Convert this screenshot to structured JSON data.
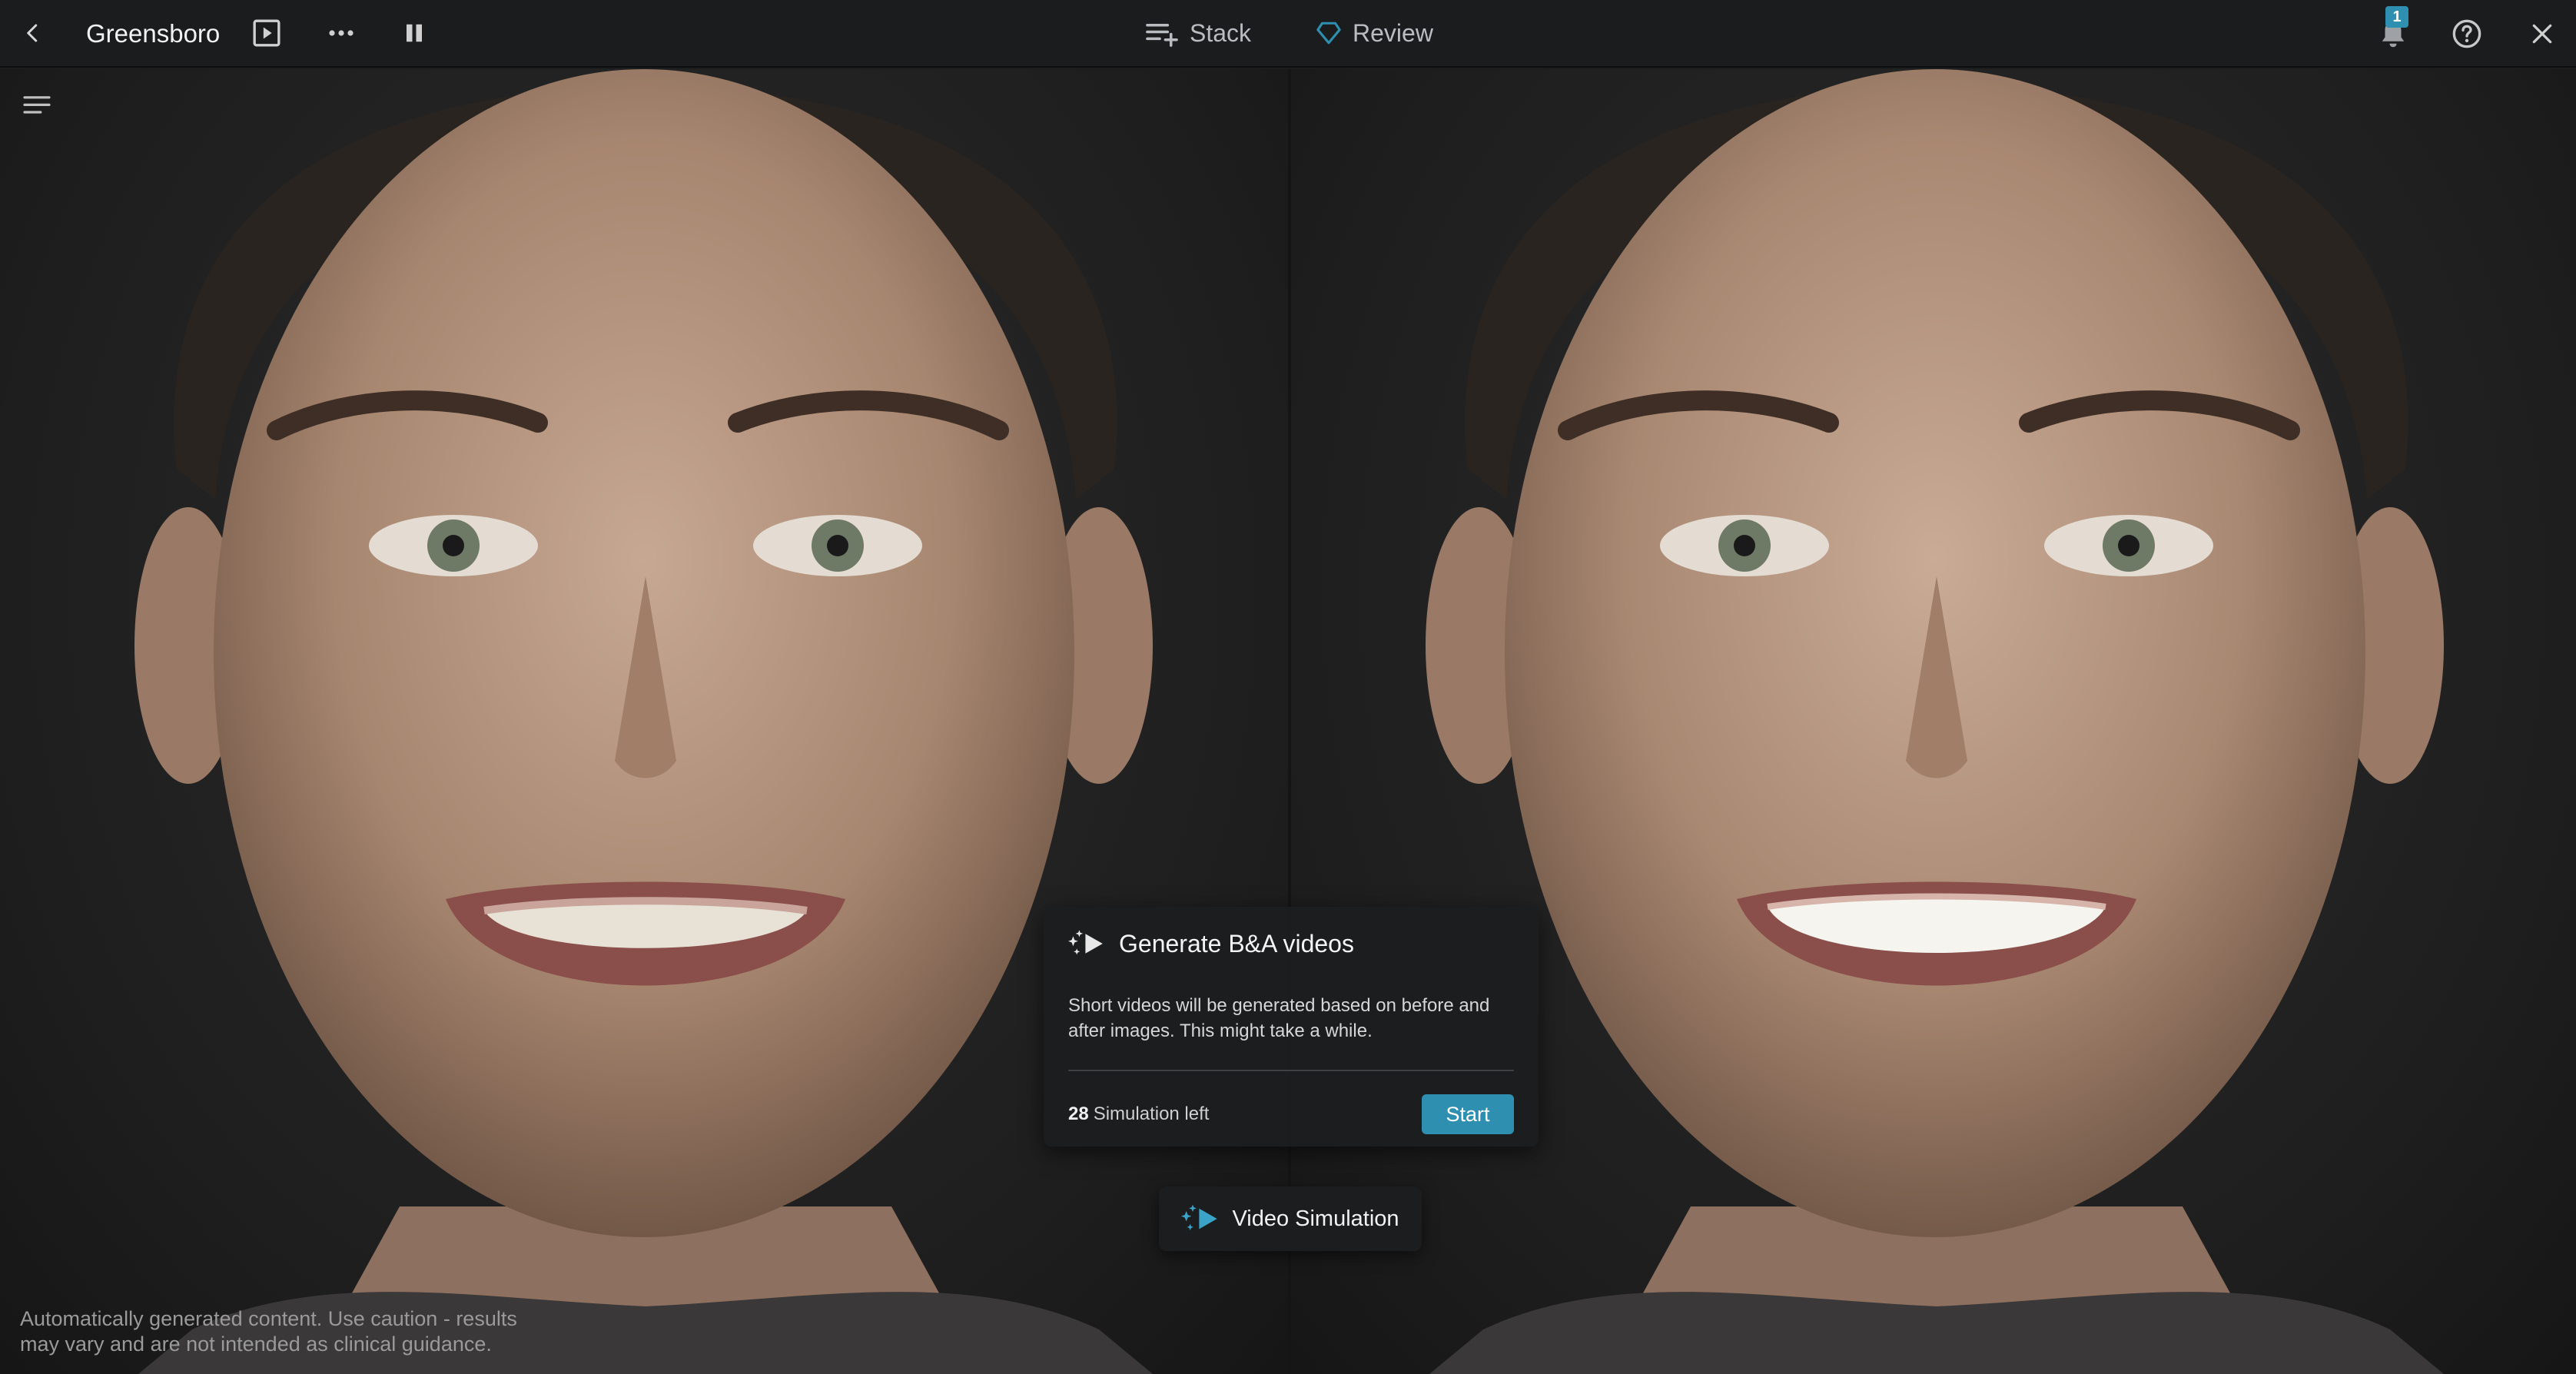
{
  "topbar": {
    "title": "Greensboro",
    "stack_label": "Stack",
    "review_label": "Review",
    "notification_count": "1",
    "icons": [
      "back-arrow-icon",
      "play-icon",
      "more-icon",
      "pause-icon",
      "stack-icon",
      "review-diamond-icon",
      "bell-icon",
      "help-icon",
      "close-icon"
    ]
  },
  "colors": {
    "accent": "#2f8fb0",
    "background": "#1b1c1e",
    "panel": "#1c1d1f"
  },
  "panel": {
    "title": "Generate B&A videos",
    "description": "Short videos will be generated based on before and after images. This might take a while.",
    "simulation_count": "28",
    "simulation_left_label": "Simulation left",
    "start_label": "Start"
  },
  "video_simulation": {
    "label": "Video Simulation"
  },
  "disclaimer": "Automatically generated content. Use caution - results may vary and are not intended as clinical guidance."
}
